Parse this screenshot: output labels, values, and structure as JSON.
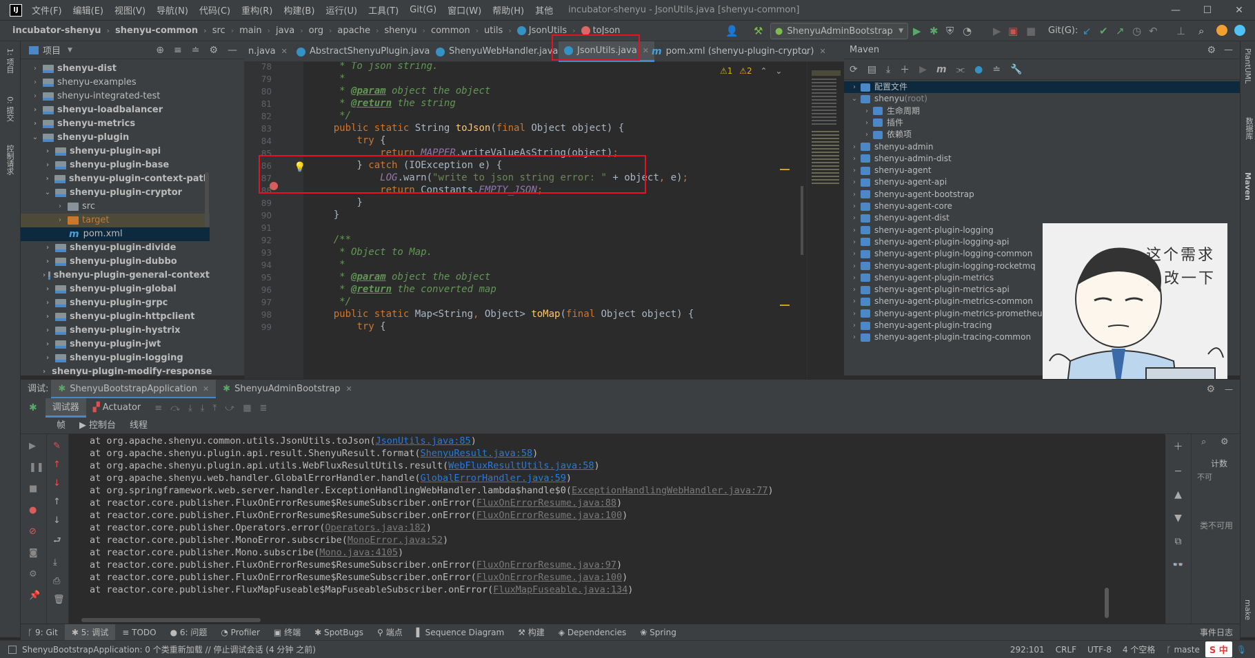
{
  "window": {
    "title": "incubator-shenyu - JsonUtils.java [shenyu-common]",
    "menu": [
      "文件(F)",
      "编辑(E)",
      "视图(V)",
      "导航(N)",
      "代码(C)",
      "重构(R)",
      "构建(B)",
      "运行(U)",
      "工具(T)",
      "Git(G)",
      "窗口(W)",
      "帮助(H)",
      "其他"
    ],
    "controls": [
      "—",
      "☐",
      "✕"
    ]
  },
  "breadcrumb": [
    "incubator-shenyu",
    "shenyu-common",
    "src",
    "main",
    "java",
    "org",
    "apache",
    "shenyu",
    "common",
    "utils",
    "JsonUtils",
    "toJson"
  ],
  "toolbar": {
    "run_config": "ShenyuAdminBootstrap",
    "git_label": "Git(G):"
  },
  "left_stripe": [
    "1: 项目",
    "0: 提交",
    "控制请求"
  ],
  "project": {
    "title": "项目",
    "items": [
      {
        "label": "shenyu-dist",
        "expanded": false
      },
      {
        "label": "shenyu-examples",
        "expanded": false
      },
      {
        "label": "shenyu-integrated-test",
        "expanded": false
      },
      {
        "label": "shenyu-loadbalancer",
        "expanded": false
      },
      {
        "label": "shenyu-metrics",
        "expanded": false
      },
      {
        "label": "shenyu-plugin",
        "expanded": true
      },
      {
        "label": "shenyu-plugin-api",
        "expanded": false
      },
      {
        "label": "shenyu-plugin-base",
        "expanded": false
      },
      {
        "label": "shenyu-plugin-context-path",
        "expanded": false
      },
      {
        "label": "shenyu-plugin-cryptor",
        "expanded": true
      },
      {
        "label": "src",
        "expanded": false
      },
      {
        "label": "target",
        "expanded": false
      },
      {
        "label": "pom.xml",
        "expanded": false
      },
      {
        "label": "shenyu-plugin-divide",
        "expanded": false
      },
      {
        "label": "shenyu-plugin-dubbo",
        "expanded": false
      },
      {
        "label": "shenyu-plugin-general-context",
        "expanded": false
      },
      {
        "label": "shenyu-plugin-global",
        "expanded": false
      },
      {
        "label": "shenyu-plugin-grpc",
        "expanded": false
      },
      {
        "label": "shenyu-plugin-httpclient",
        "expanded": false
      },
      {
        "label": "shenyu-plugin-hystrix",
        "expanded": false
      },
      {
        "label": "shenyu-plugin-jwt",
        "expanded": false
      },
      {
        "label": "shenyu-plugin-logging",
        "expanded": false
      },
      {
        "label": "shenyu-plugin-modify-response",
        "expanded": false
      }
    ]
  },
  "editor": {
    "tabs": [
      {
        "label": "n.java",
        "active": false
      },
      {
        "label": "AbstractShenyuPlugin.java",
        "active": false
      },
      {
        "label": "ShenyuWebHandler.java",
        "active": false
      },
      {
        "label": "JsonUtils.java",
        "active": true
      },
      {
        "label": "pom.xml (shenyu-plugin-cryptor)",
        "active": false
      }
    ],
    "inspections": {
      "warnings": "1",
      "weak_warnings": "2"
    },
    "line_numbers": [
      "78",
      "79",
      "80",
      "81",
      "82",
      "83",
      "84",
      "85",
      "86",
      "87",
      "88",
      "89",
      "90",
      "91",
      "92",
      "93",
      "94",
      "95",
      "96",
      "97",
      "98",
      "99"
    ]
  },
  "maven": {
    "title": "Maven",
    "items": [
      {
        "label": "配置文件",
        "level": 0
      },
      {
        "label": "shenyu",
        "suffix": " (root)",
        "level": 0
      },
      {
        "label": "生命周期",
        "level": 1
      },
      {
        "label": "插件",
        "level": 1
      },
      {
        "label": "依赖项",
        "level": 1
      },
      {
        "label": "shenyu-admin",
        "level": 0
      },
      {
        "label": "shenyu-admin-dist",
        "level": 0
      },
      {
        "label": "shenyu-agent",
        "level": 0
      },
      {
        "label": "shenyu-agent-api",
        "level": 0
      },
      {
        "label": "shenyu-agent-bootstrap",
        "level": 0
      },
      {
        "label": "shenyu-agent-core",
        "level": 0
      },
      {
        "label": "shenyu-agent-dist",
        "level": 0
      },
      {
        "label": "shenyu-agent-plugin-logging",
        "level": 0
      },
      {
        "label": "shenyu-agent-plugin-logging-api",
        "level": 0
      },
      {
        "label": "shenyu-agent-plugin-logging-common",
        "level": 0
      },
      {
        "label": "shenyu-agent-plugin-logging-rocketmq",
        "level": 0
      },
      {
        "label": "shenyu-agent-plugin-metrics",
        "level": 0
      },
      {
        "label": "shenyu-agent-plugin-metrics-api",
        "level": 0
      },
      {
        "label": "shenyu-agent-plugin-metrics-common",
        "level": 0
      },
      {
        "label": "shenyu-agent-plugin-metrics-prometheus",
        "level": 0
      },
      {
        "label": "shenyu-agent-plugin-tracing",
        "level": 0
      },
      {
        "label": "shenyu-agent-plugin-tracing-common",
        "level": 0
      }
    ]
  },
  "right_stripe": [
    "PlantUML",
    "数据库",
    "Maven",
    "make"
  ],
  "meme": {
    "line1": "这个需求",
    "line2": "改一下"
  },
  "debug": {
    "label": "调试:",
    "tabs": [
      "ShenyuBootstrapApplication",
      "ShenyuAdminBootstrap"
    ],
    "subtabs": [
      "调试器",
      "Actuator"
    ],
    "views": [
      "帧",
      "控制台",
      "线程"
    ],
    "side_right": [
      "不可",
      "类不可用",
      "计数"
    ],
    "stack": [
      {
        "prefix": "at org.apache.shenyu.common.utils.JsonUtils.toJson(",
        "link": "JsonUtils.java:85",
        "dim": false
      },
      {
        "prefix": "at org.apache.shenyu.plugin.api.result.ShenyuResult.format(",
        "link": "ShenyuResult.java:58",
        "dim": false
      },
      {
        "prefix": "at org.apache.shenyu.plugin.api.utils.WebFluxResultUtils.result(",
        "link": "WebFluxResultUtils.java:58",
        "dim": false
      },
      {
        "prefix": "at org.apache.shenyu.web.handler.GlobalErrorHandler.handle(",
        "link": "GlobalErrorHandler.java:59",
        "dim": false
      },
      {
        "prefix": "at org.springframework.web.server.handler.ExceptionHandlingWebHandler.lambda$handle$0(",
        "link": "ExceptionHandlingWebHandler.java:77",
        "dim": true
      },
      {
        "prefix": "at reactor.core.publisher.FluxOnErrorResume$ResumeSubscriber.onError(",
        "link": "FluxOnErrorResume.java:88",
        "dim": true
      },
      {
        "prefix": "at reactor.core.publisher.FluxOnErrorResume$ResumeSubscriber.onError(",
        "link": "FluxOnErrorResume.java:100",
        "dim": true
      },
      {
        "prefix": "at reactor.core.publisher.Operators.error(",
        "link": "Operators.java:182",
        "dim": true
      },
      {
        "prefix": "at reactor.core.publisher.MonoError.subscribe(",
        "link": "MonoError.java:52",
        "dim": true
      },
      {
        "prefix": "at reactor.core.publisher.Mono.subscribe(",
        "link": "Mono.java:4105",
        "dim": true
      },
      {
        "prefix": "at reactor.core.publisher.FluxOnErrorResume$ResumeSubscriber.onError(",
        "link": "FluxOnErrorResume.java:97",
        "dim": true
      },
      {
        "prefix": "at reactor.core.publisher.FluxOnErrorResume$ResumeSubscriber.onError(",
        "link": "FluxOnErrorResume.java:100",
        "dim": true
      },
      {
        "prefix": "at reactor.core.publisher.FluxMapFuseable$MapFuseableSubscriber.onError(",
        "link": "FluxMapFuseable.java:134",
        "dim": true
      }
    ]
  },
  "bottom_tools": [
    "9: Git",
    "5: 调试",
    "TODO",
    "6: 问题",
    "Profiler",
    "终端",
    "SpotBugs",
    "端点",
    "Sequence Diagram",
    "构建",
    "Dependencies",
    "Spring"
  ],
  "bottom_right": "事件日志",
  "status": {
    "message": "ShenyuBootstrapApplication: 0 个类重新加载 // 停止调试会话 (4 分钟 之前)",
    "position": "292:101",
    "line_sep": "CRLF",
    "encoding": "UTF-8",
    "indent": "4 个空格",
    "branch": "maste",
    "ime": "中"
  },
  "colors": {
    "background": "#2b2b2b",
    "panel": "#3c3f41",
    "highlight_box": "#e81123",
    "link": "#287bde",
    "keyword": "#cc7832"
  }
}
